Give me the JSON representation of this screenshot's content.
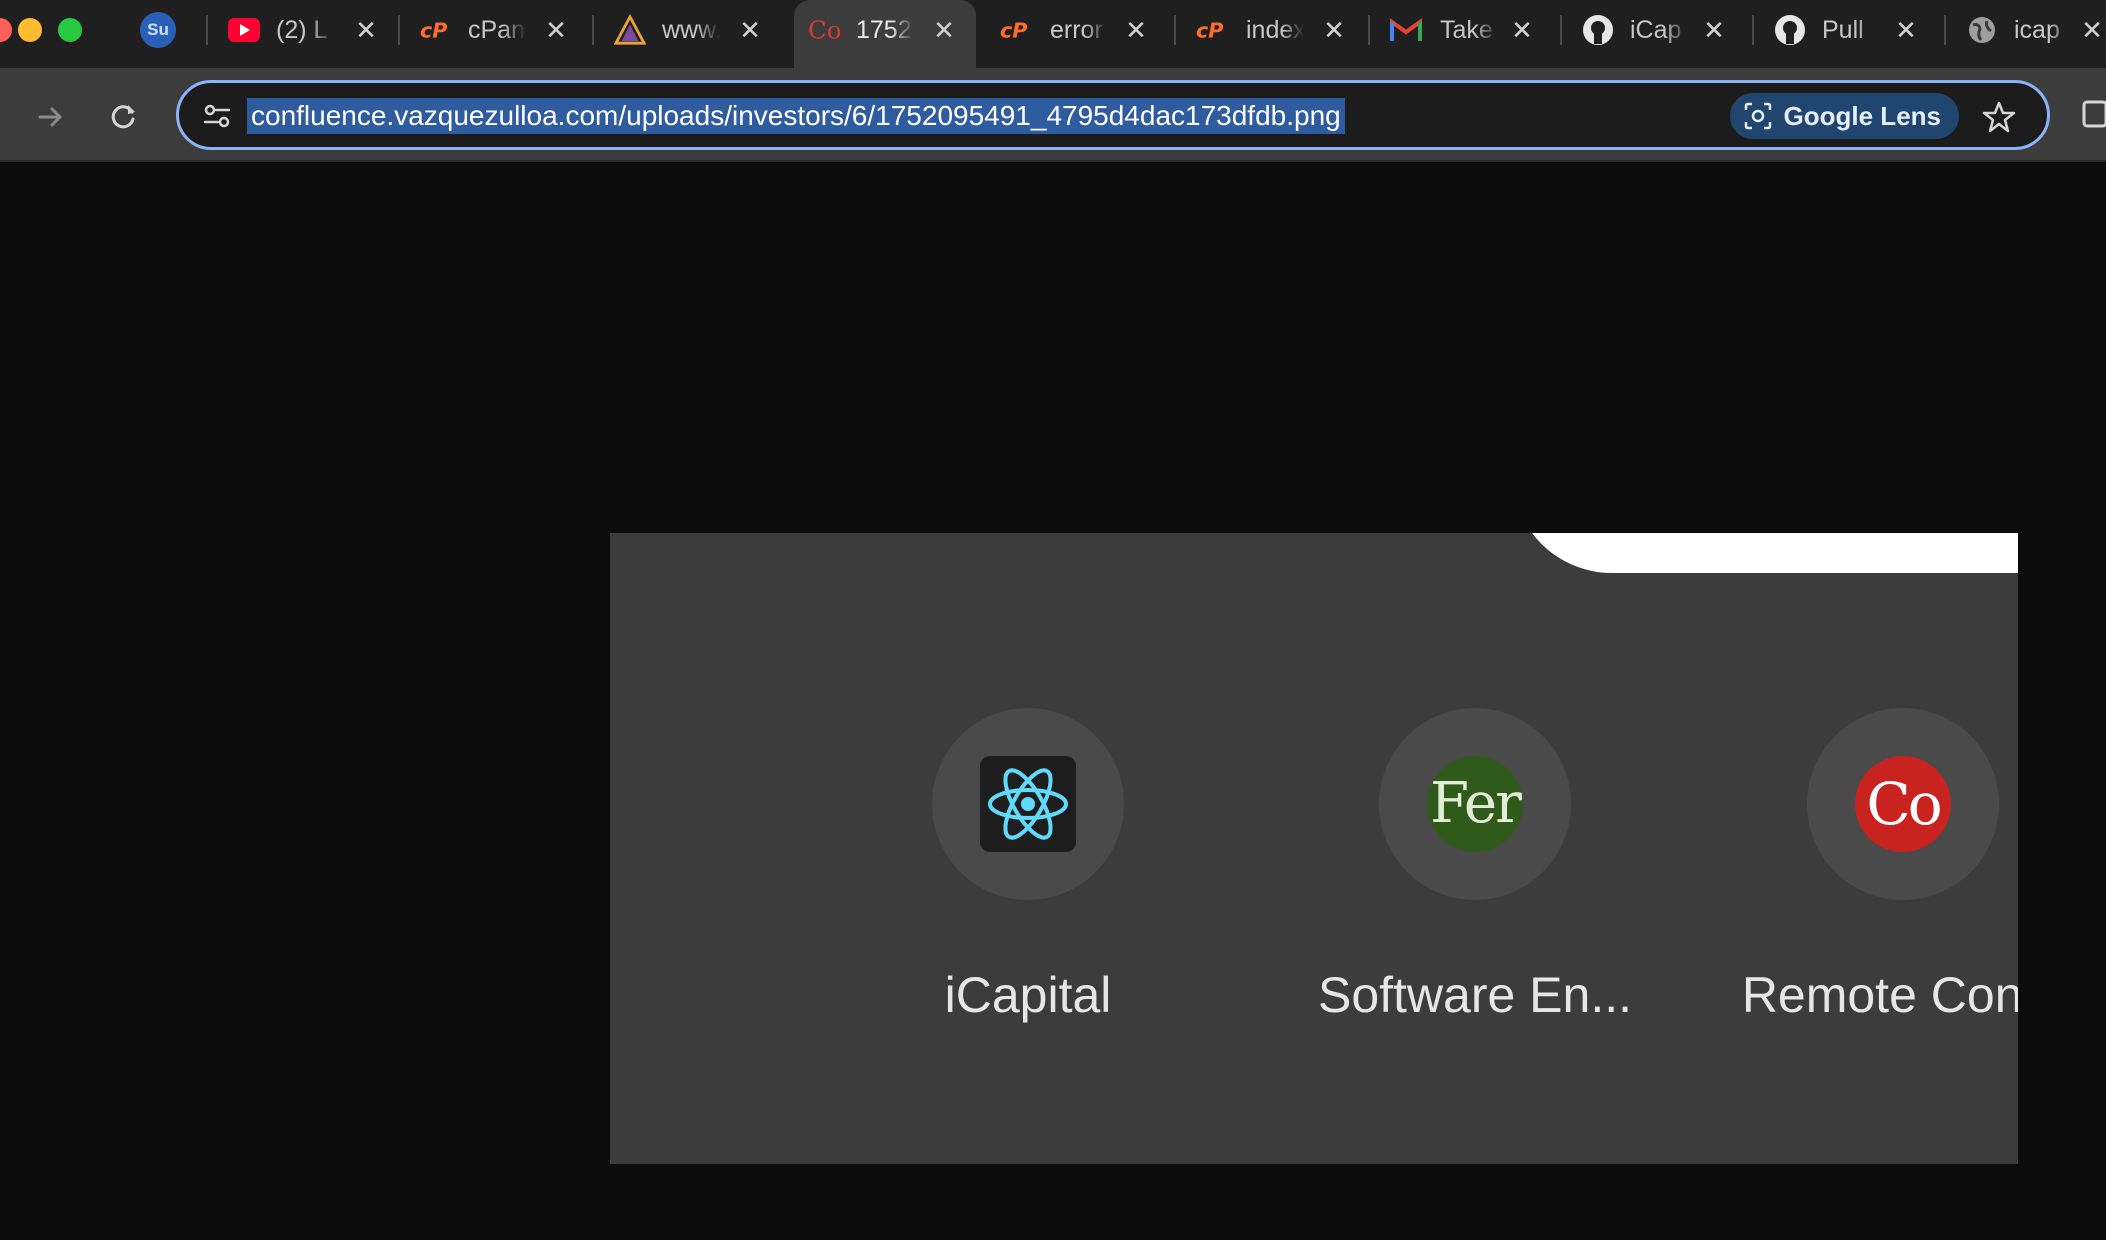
{
  "colors": {
    "accent": "#8ab4f8",
    "tabstrip_bg": "#1f1f1f",
    "toolbar_bg": "#3c3c3c",
    "page_bg": "#0c0c0c",
    "url_selection": "#2f5b9f",
    "lens_bg": "#20456f"
  },
  "window_controls": [
    "close",
    "minimize",
    "zoom"
  ],
  "tabs": {
    "pinned": {
      "favicon_text": "Su",
      "icon": "su-favicon-icon"
    },
    "items": [
      {
        "favicon": "youtube-icon",
        "title": "(2) L"
      },
      {
        "favicon": "cpanel-icon",
        "title": "cPan"
      },
      {
        "favicon": "www-triangle-icon",
        "title": "www."
      },
      {
        "favicon": "co-favicon-icon",
        "favicon_text": "Co",
        "title": "1752",
        "active": true
      },
      {
        "favicon": "cpanel-icon",
        "title": "error"
      },
      {
        "favicon": "cpanel-icon",
        "title": "index"
      },
      {
        "favicon": "gmail-icon",
        "title": "Take"
      },
      {
        "favicon": "github-icon",
        "title": "iCap"
      },
      {
        "favicon": "github-icon",
        "title": "Pull"
      },
      {
        "favicon": "globe-icon",
        "title": "icap"
      }
    ],
    "close_glyph": "✕"
  },
  "toolbar": {
    "forward_icon": "arrow-right-icon",
    "reload_icon": "reload-icon",
    "site_info_icon": "tune-icon",
    "url": "confluence.vazquezulloa.com/uploads/investors/6/1752095491_4795d4dac173dfdb.png",
    "lens_label": "Google Lens",
    "bookmark_icon": "star-icon"
  },
  "image_content": {
    "shortcuts": [
      {
        "label": "iCapital",
        "icon": "react-atom-icon"
      },
      {
        "label": "Software En...",
        "icon_text": "Fer",
        "icon": "fer-tile-icon"
      },
      {
        "label": "Remote Con...",
        "icon_text": "Co",
        "icon": "co-tile-icon"
      }
    ]
  }
}
